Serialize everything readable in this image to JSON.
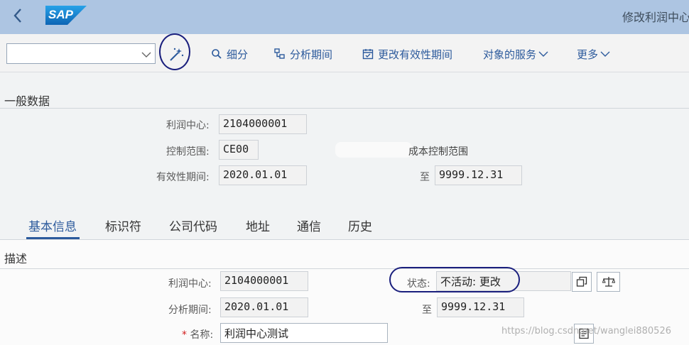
{
  "shell": {
    "title": "修改利润中心",
    "back_icon": "chevron-left-icon",
    "logo_text": "SAP",
    "logo_color": "#1b73c0"
  },
  "toolbar": {
    "command_field_value": "",
    "items": [
      {
        "label": "细分",
        "icon": "magnifier-icon"
      },
      {
        "label": "分析期间",
        "icon": "hierarchy-icon"
      },
      {
        "label": "更改有效性期间",
        "icon": "calendar-icon"
      },
      {
        "label": "对象的服务",
        "icon": "chevron-down-icon"
      },
      {
        "label": "更多",
        "icon": "chevron-down-icon"
      }
    ]
  },
  "general": {
    "title": "一般数据",
    "profit_center_label": "利润中心:",
    "profit_center_value": "2104000001",
    "controlling_area_label": "控制范围:",
    "controlling_area_value": "CE00",
    "controlling_area_desc": "成本控制范围",
    "validity_label": "有效性期间:",
    "validity_from": "2020.01.01",
    "to_label": "至",
    "validity_to": "9999.12.31"
  },
  "tabs": [
    "基本信息",
    "标识符",
    "公司代码",
    "地址",
    "通信",
    "历史"
  ],
  "description": {
    "title": "描述",
    "profit_center_label": "利润中心:",
    "profit_center_value": "2104000001",
    "status_label": "状态:",
    "status_value": "不活动: 更改",
    "analysis_period_label": "分析期间:",
    "analysis_from": "2020.01.01",
    "to_label": "至",
    "analysis_to": "9999.12.31",
    "required_mark": "*",
    "name_label": "名称:",
    "name_value": "利润中心测试"
  },
  "watermark": "https://blog.csdn.net/wanglei880526"
}
